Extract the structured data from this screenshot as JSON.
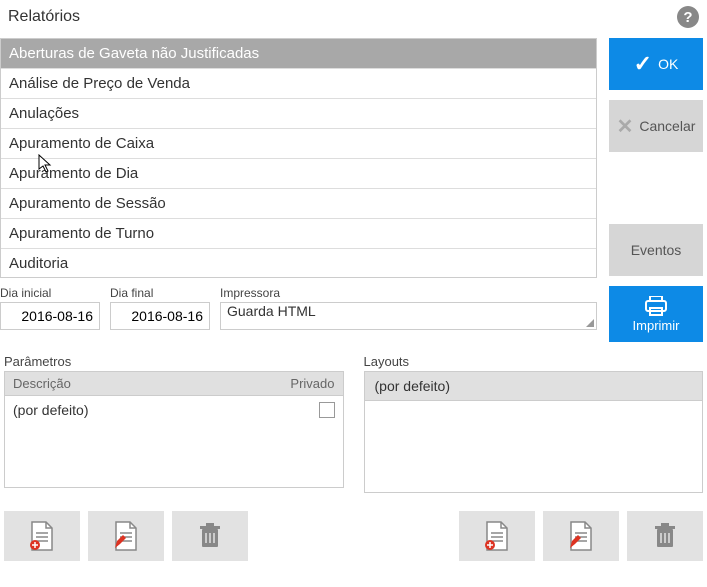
{
  "header": {
    "title": "Relatórios"
  },
  "reports": [
    "Aberturas de Gaveta não Justificadas",
    "Análise de Preço de Venda",
    "Anulações",
    "Apuramento de Caixa",
    "Apuramento de Dia",
    "Apuramento de Sessão",
    "Apuramento de Turno",
    "Auditoria"
  ],
  "buttons": {
    "ok": "OK",
    "cancel": "Cancelar",
    "events": "Eventos",
    "print": "Imprimir"
  },
  "fields": {
    "start_date_label": "Dia inicial",
    "start_date_value": "2016-08-16",
    "end_date_label": "Dia final",
    "end_date_value": "2016-08-16",
    "printer_label": "Impressora",
    "printer_value": "Guarda HTML"
  },
  "params": {
    "title": "Parâmetros",
    "col_desc": "Descrição",
    "col_priv": "Privado",
    "rows": [
      {
        "desc": "(por defeito)",
        "priv": false
      }
    ]
  },
  "layouts": {
    "title": "Layouts",
    "selected": "(por defeito)"
  }
}
